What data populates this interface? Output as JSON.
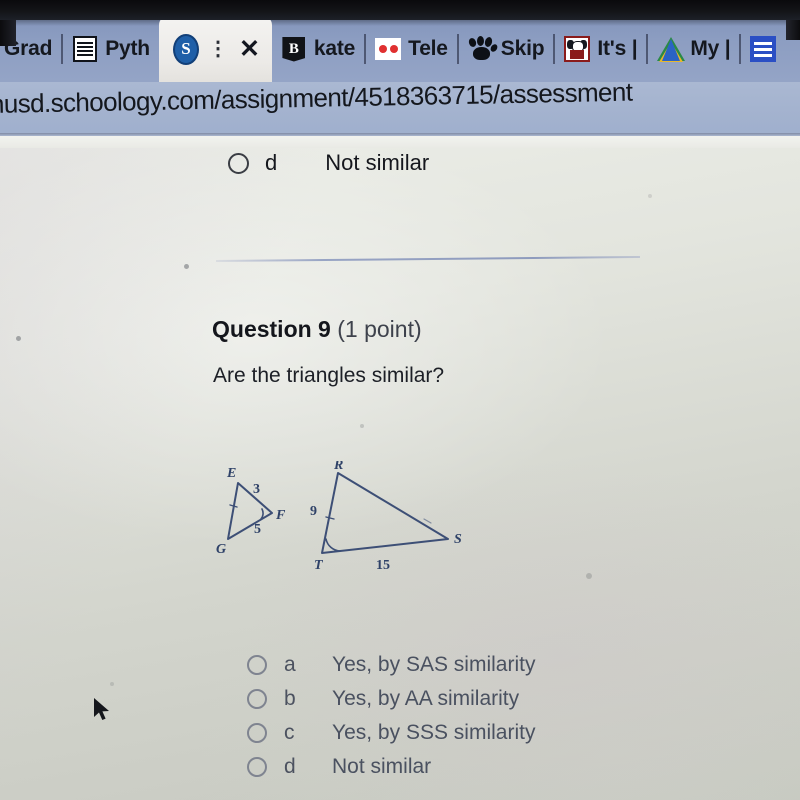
{
  "browser": {
    "tabs": [
      {
        "label": "Grad",
        "icon": "none-icon",
        "active": false
      },
      {
        "label": "Pyth",
        "icon": "document-lines-icon",
        "active": false
      },
      {
        "label": "",
        "icon": "schoology-s-icon",
        "active": true,
        "close_label": "✕",
        "menu_label": "⋮"
      },
      {
        "label": "kate",
        "icon": "black-b-flag-icon",
        "active": false
      },
      {
        "label": "Tele",
        "icon": "two-red-dots-icon",
        "active": false
      },
      {
        "label": "Skip",
        "icon": "paw-print-icon",
        "active": false
      },
      {
        "label": "It's |",
        "icon": "dog-face-icon",
        "active": false
      },
      {
        "label": "My |",
        "icon": "google-drive-icon",
        "active": false
      },
      {
        "label": "",
        "icon": "blue-menu-icon",
        "active": false
      }
    ],
    "url": "nusd.schoology.com/assignment/4518363715/assessment"
  },
  "previous_question_tail": {
    "letter": "d",
    "text": "Not similar"
  },
  "question": {
    "number_label": "Question 9",
    "points_label": "(1 point)",
    "prompt": "Are the triangles similar?",
    "options": [
      {
        "letter": "a",
        "text": "Yes, by SAS similarity"
      },
      {
        "letter": "b",
        "text": "Yes, by AA similarity"
      },
      {
        "letter": "c",
        "text": "Yes, by SSS similarity"
      },
      {
        "letter": "d",
        "text": "Not similar"
      }
    ]
  },
  "figure": {
    "description": "Two triangles diagram",
    "small_triangle": {
      "vertices": [
        "E",
        "F",
        "G"
      ],
      "side_labels": [
        "3",
        "5"
      ],
      "marked_angle_vertex": "F"
    },
    "large_triangle": {
      "vertices": [
        "R",
        "S",
        "T"
      ],
      "side_labels": [
        "9",
        "15"
      ],
      "marked_angle_vertex": "T"
    }
  },
  "colors": {
    "tabstrip": "#8d9ec2",
    "urlbar": "#a4b3cf",
    "page": "#e3e5de",
    "figure_ink": "#3d4f76",
    "divider": "#98a4c4",
    "option_text": "#4a5160"
  }
}
